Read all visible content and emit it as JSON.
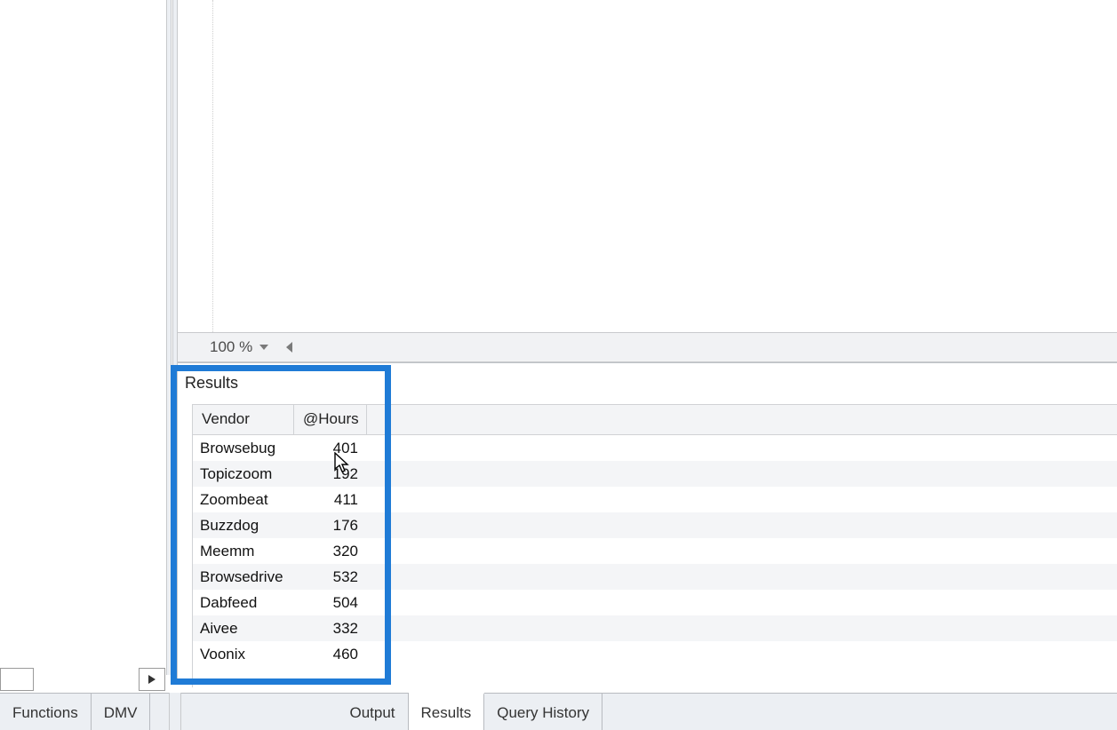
{
  "zoom": {
    "value": "100 %"
  },
  "results": {
    "title": "Results",
    "columns": [
      "Vendor",
      "@Hours"
    ],
    "rows": [
      {
        "vendor": "Browsebug",
        "hours": "401"
      },
      {
        "vendor": "Topiczoom",
        "hours": "192"
      },
      {
        "vendor": "Zoombeat",
        "hours": "411"
      },
      {
        "vendor": "Buzzdog",
        "hours": "176"
      },
      {
        "vendor": "Meemm",
        "hours": "320"
      },
      {
        "vendor": "Browsedrive",
        "hours": "532"
      },
      {
        "vendor": "Dabfeed",
        "hours": "504"
      },
      {
        "vendor": "Aivee",
        "hours": "332"
      },
      {
        "vendor": "Voonix",
        "hours": "460"
      }
    ]
  },
  "tabs_left": [
    {
      "label": "Functions"
    },
    {
      "label": "DMV"
    }
  ],
  "tabs_right": [
    {
      "label": "Output"
    },
    {
      "label": "Results",
      "active": true
    },
    {
      "label": "Query History"
    }
  ]
}
